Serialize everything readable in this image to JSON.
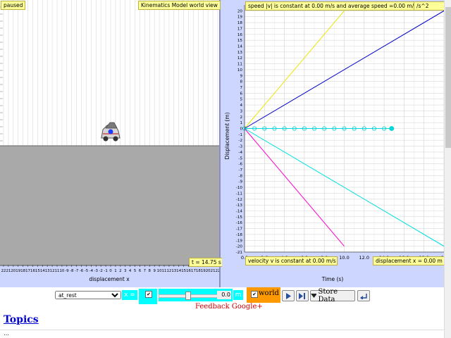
{
  "world": {
    "status": "paused",
    "title": "Kinematics Model world view",
    "time": "t = 14.75 s",
    "axis_label": "displacement x",
    "ticks": [
      "22",
      "21",
      "20",
      "19",
      "18",
      "17",
      "16",
      "15",
      "14",
      "13",
      "12",
      "11",
      "10",
      "-9",
      "-8",
      "-7",
      "-6",
      "-5",
      "-4",
      "-3",
      "-2",
      "-1",
      "0",
      "1",
      "2",
      "3",
      "4",
      "5",
      "6",
      "7",
      "8",
      "9",
      "10",
      "11",
      "12",
      "13",
      "14",
      "15",
      "16",
      "17",
      "18",
      "19",
      "20",
      "21",
      "22"
    ]
  },
  "graph": {
    "top_label": "speed |v| is constant at 0.00 m/s and average speed =0.00 m/s",
    "top_right_label": "/s^2",
    "velocity_label": "velocity v is constant at 0.00 m/s",
    "displacement_label": "displacement x = 0.00 m",
    "ylabel": "Displacement (m)",
    "xlabel": "Time (s)",
    "xticks": [
      "0.0",
      "2.0",
      "4.0",
      "6.0",
      "8.0",
      "10.0",
      "12.0",
      "14.0",
      "16.0",
      "18.0",
      "20"
    ],
    "yticks": [
      "20",
      "19",
      "18",
      "17",
      "16",
      "15",
      "14",
      "13",
      "12",
      "11",
      "10",
      "9",
      "8",
      "7",
      "6",
      "5",
      "4",
      "3",
      "2",
      "1",
      "0",
      "-1",
      "-2",
      "-3",
      "-4",
      "-5",
      "-6",
      "-7",
      "-8",
      "-9",
      "-10",
      "-11",
      "-12",
      "-13",
      "-14",
      "-15",
      "-16",
      "-17",
      "-18",
      "-19",
      "-20",
      "-21"
    ]
  },
  "chart_data": {
    "type": "line",
    "xlabel": "Time (s)",
    "ylabel": "Displacement (m)",
    "xlim": [
      0,
      20
    ],
    "ylim": [
      -21,
      21
    ],
    "grid": true,
    "series": [
      {
        "color": "#e8e800",
        "x": [
          0,
          10
        ],
        "y": [
          0,
          20
        ]
      },
      {
        "color": "#0000cc",
        "x": [
          0,
          20
        ],
        "y": [
          0,
          20
        ]
      },
      {
        "color": "#00e0e0",
        "x": [
          0,
          20
        ],
        "y": [
          0,
          -20
        ]
      },
      {
        "color": "#ff00cc",
        "x": [
          0,
          10
        ],
        "y": [
          0,
          -20
        ]
      },
      {
        "color": "#00dada",
        "x": [
          0,
          1,
          2,
          3,
          4,
          5,
          6,
          7,
          8,
          9,
          10,
          11,
          12,
          13,
          14,
          14.75
        ],
        "y": [
          0,
          0,
          0,
          0,
          0,
          0,
          0,
          0,
          0,
          0,
          0,
          0,
          0,
          0,
          0,
          0
        ]
      }
    ]
  },
  "controls": {
    "preset_value": "at_rest",
    "x_label": "x =",
    "checkbox_mark": "✔",
    "slider_value": "0.0",
    "unit": "m",
    "world_label": "world",
    "store_label": "Store Data",
    "feedback": "Feedback Google+"
  },
  "page": {
    "topics": "Topics",
    "bullet": "…"
  }
}
